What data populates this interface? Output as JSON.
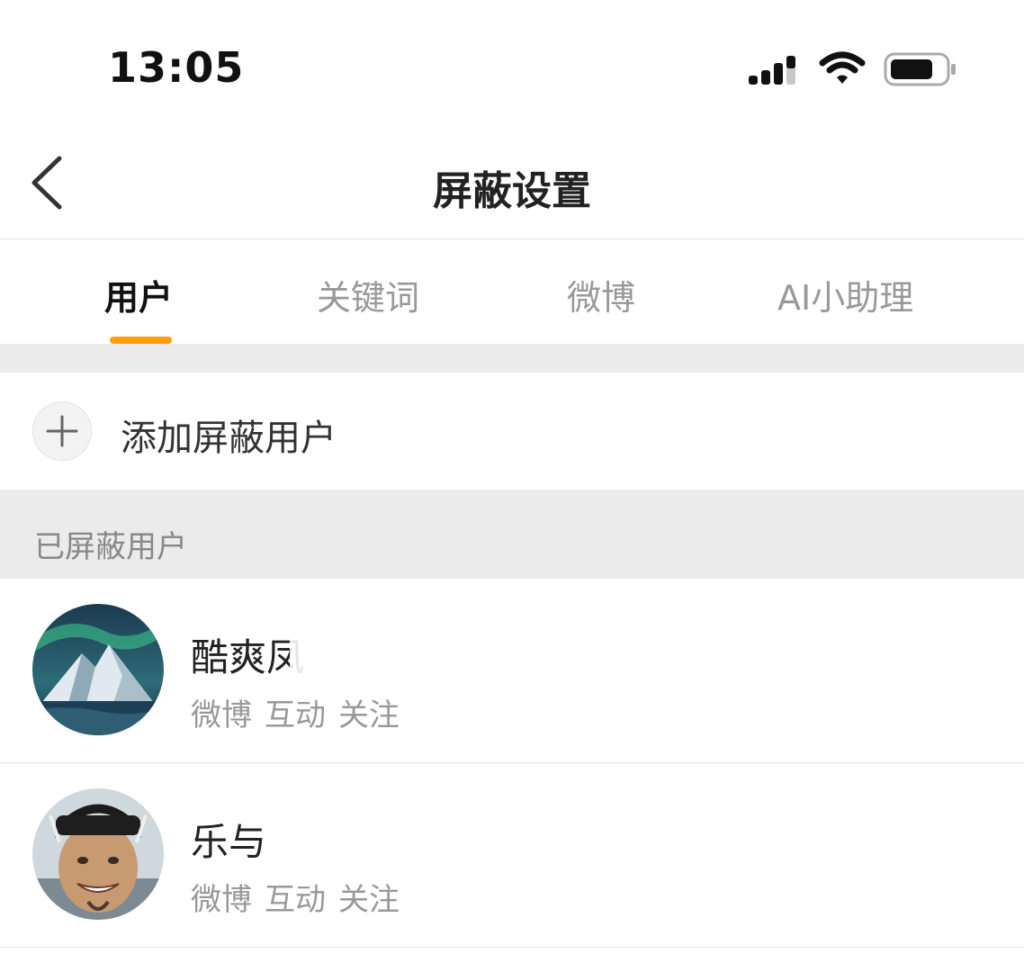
{
  "status": {
    "time": "13:05"
  },
  "nav": {
    "title": "屏蔽设置"
  },
  "tabs": [
    {
      "label": "用户",
      "active": true
    },
    {
      "label": "关键词",
      "active": false
    },
    {
      "label": "微博",
      "active": false
    },
    {
      "label": "AI小助理",
      "active": false
    }
  ],
  "add": {
    "label": "添加屏蔽用户"
  },
  "section": {
    "label": "已屏蔽用户"
  },
  "users": [
    {
      "name": "酷爽凤",
      "tags": [
        "微博",
        "互动",
        "关注"
      ],
      "avatar": "aurora-mountain"
    },
    {
      "name": "乐与",
      "tags": [
        "微博",
        "互动",
        "关注"
      ],
      "avatar": "smiling-man"
    }
  ],
  "accent_color": "#ff9d0a"
}
